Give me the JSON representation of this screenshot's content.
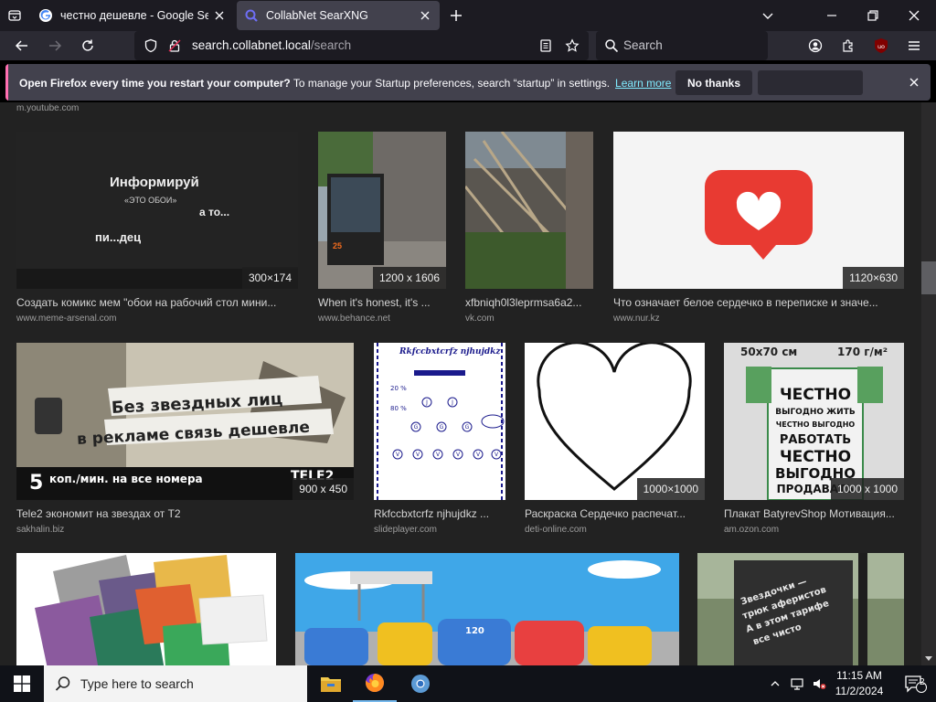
{
  "browser": {
    "tabs": [
      {
        "title": "честно дешевле - Google Search",
        "active": false
      },
      {
        "title": "CollabNet SearXNG",
        "active": true
      }
    ],
    "url": {
      "host": "search.collabnet.local",
      "path": "/search"
    },
    "search_placeholder": "Search"
  },
  "notification": {
    "title": "Open Firefox every time you restart your computer?",
    "text": "To manage your Startup preferences, search “startup” in settings.",
    "link": "Learn more",
    "button": "No thanks"
  },
  "results": {
    "partial_domain": "m.youtube.com",
    "cards": [
      {
        "title": "Создать комикс мем \"обои на рабочий стол мини...",
        "domain": "www.meme-arsenal.com",
        "resolution": "300×174",
        "thumb_text": [
          "Информируй",
          "«ЭТО ОБОИ»",
          "а то...",
          "пи...дец"
        ]
      },
      {
        "title": "When it's honest, it's ...",
        "domain": "www.behance.net",
        "resolution": "1200 x 1606",
        "thumb_text": [
          "25"
        ]
      },
      {
        "title": "xfbniqh0l3leprmsa6a2...",
        "domain": "vk.com",
        "resolution": ""
      },
      {
        "title": "Что означает белое сердечко в переписке и значе...",
        "domain": "www.nur.kz",
        "resolution": "1120×630"
      },
      {
        "title": "Tele2 экономит на звездах от Т2",
        "domain": "sakhalin.biz",
        "resolution": "900 x 450",
        "thumb_text": [
          "Без звездных лиц",
          "в рекламе связь дешевле",
          "5",
          "коп./мин. на все номера",
          "TELE2"
        ]
      },
      {
        "title": "Rkfccbxtcrfz njhujdkz ...",
        "domain": "slideplayer.com",
        "resolution": "",
        "thumb_text": [
          "Rkfccbxtcrfz njhujdkz",
          "20 %",
          "80 %",
          "J",
          "J",
          "G",
          "G",
          "G",
          "V",
          "V",
          "V",
          "V",
          "V",
          "V"
        ]
      },
      {
        "title": "Раскраска Сердечко распечат...",
        "domain": "deti-online.com",
        "resolution": "1000×1000"
      },
      {
        "title": "Плакат BatyrevShop Мотивация...",
        "domain": "am.ozon.com",
        "resolution": "1000 x 1000",
        "thumb_text": [
          "50х70 см",
          "170 г/м²",
          "ЧЕСТНО",
          "ВЫГОДНО ЖИТЬ",
          "ЧЕСТНО ВЫГОДНО",
          "РАБОТАТЬ",
          "ЧЕСТНО",
          "ВЫГОДНО",
          "ПРОДАВАТЬ"
        ]
      },
      {
        "title": "",
        "domain": "",
        "resolution": ""
      },
      {
        "title": "",
        "domain": "",
        "resolution": "",
        "thumb_text": [
          "120"
        ]
      },
      {
        "title": "",
        "domain": "",
        "resolution": "",
        "thumb_text": [
          "Звездочки —",
          "трюк аферистов",
          "А в этом тарифе",
          "все чисто"
        ]
      }
    ]
  },
  "taskbar": {
    "search_placeholder": "Type here to search",
    "time": "11:15 AM",
    "date": "11/2/2024",
    "notification_count": "2"
  },
  "colors": {
    "accent": "#80ebff",
    "notif_bar": "#ff6fb0",
    "tab_active": "#42414d"
  }
}
